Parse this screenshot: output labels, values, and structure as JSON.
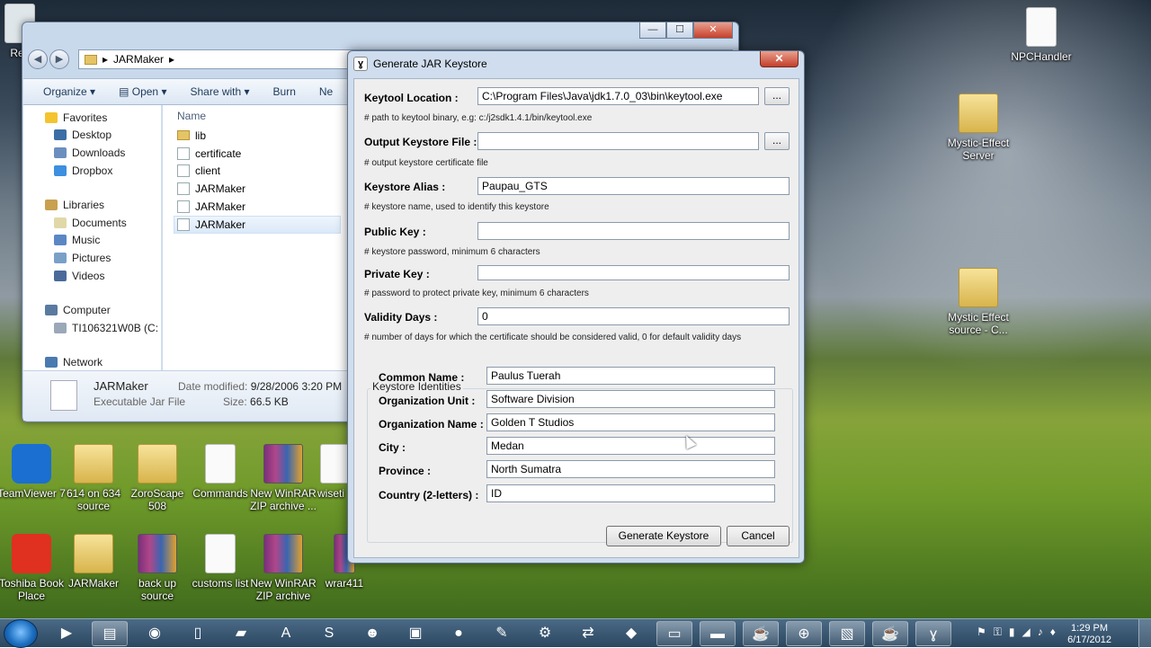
{
  "desktop": {
    "icons": [
      {
        "label": "Rec",
        "icon": "recycle-bin-icon"
      },
      {
        "label": "NPCHandler",
        "icon": "document-icon"
      },
      {
        "label": "Mystic-Effect Server",
        "icon": "folder-icon"
      },
      {
        "label": "Mystic Effect source - C...",
        "icon": "folder-icon"
      },
      {
        "label": "TeamViewer 7",
        "icon": "teamviewer-icon"
      },
      {
        "label": "614 on 634 source",
        "icon": "folder-icon"
      },
      {
        "label": "ZoroScape 508",
        "icon": "folder-icon"
      },
      {
        "label": "Commands",
        "icon": "document-icon"
      },
      {
        "label": "New WinRAR ZIP archive ...",
        "icon": "winrar-icon"
      },
      {
        "label": "wiseti",
        "icon": "document-icon"
      },
      {
        "label": "Toshiba Book Place",
        "icon": "toshiba-icon"
      },
      {
        "label": "JARMaker",
        "icon": "folder-icon"
      },
      {
        "label": "back up source",
        "icon": "winrar-icon"
      },
      {
        "label": "customs list",
        "icon": "document-icon"
      },
      {
        "label": "New WinRAR ZIP archive",
        "icon": "winrar-icon"
      },
      {
        "label": "wrar411",
        "icon": "winrar-icon"
      }
    ]
  },
  "explorer": {
    "breadcrumb": "JARMaker",
    "toolbar": {
      "organize": "Organize",
      "open": "Open",
      "share": "Share with",
      "burn": "Burn",
      "new": "Ne"
    },
    "nav": {
      "favorites": "Favorites",
      "fav_items": [
        "Desktop",
        "Downloads",
        "Dropbox"
      ],
      "libraries": "Libraries",
      "lib_items": [
        "Documents",
        "Music",
        "Pictures",
        "Videos"
      ],
      "computer": "Computer",
      "drive": "TI106321W0B (C:",
      "network": "Network"
    },
    "column_name": "Name",
    "files": [
      "lib",
      "certificate",
      "client",
      "JARMaker",
      "JARMaker",
      "JARMaker"
    ],
    "details": {
      "name": "JARMaker",
      "type": "Executable Jar File",
      "modified_label": "Date modified:",
      "modified": "9/28/2006 3:20 PM",
      "size_label": "Size:",
      "size": "66.5 KB"
    }
  },
  "dialog": {
    "title": "Generate JAR Keystore",
    "close": "✕",
    "keytool": {
      "label": "Keytool Location :",
      "value": "C:\\Program Files\\Java\\jdk1.7.0_03\\bin\\keytool.exe",
      "hint": "# path to keytool binary, e.g: c:/j2sdk1.4.1/bin/keytool.exe",
      "browse": "..."
    },
    "output": {
      "label": "Output Keystore File :",
      "value": "",
      "hint": "# output keystore certificate file",
      "browse": "..."
    },
    "alias": {
      "label": "Keystore Alias :",
      "value": "Paupau_GTS",
      "hint": "# keystore name, used to identify this keystore"
    },
    "public_key": {
      "label": "Public Key :",
      "value": "",
      "hint": "# keystore password, minimum 6 characters"
    },
    "private_key": {
      "label": "Private Key :",
      "value": "",
      "hint": "# password to protect private key, minimum 6 characters"
    },
    "validity": {
      "label": "Validity Days :",
      "value": "0",
      "hint": "# number of days for which the certificate should be considered valid, 0 for default validity days"
    },
    "identities_title": "Keystore Identities",
    "identities": [
      {
        "label": "Common Name :",
        "value": "Paulus Tuerah"
      },
      {
        "label": "Organization Unit :",
        "value": "Software Division"
      },
      {
        "label": "Organization Name :",
        "value": "Golden T Studios"
      },
      {
        "label": "City :",
        "value": "Medan"
      },
      {
        "label": "Province :",
        "value": "North Sumatra"
      },
      {
        "label": "Country (2-letters) :",
        "value": "ID"
      }
    ],
    "generate_button": "Generate Keystore",
    "cancel_button": "Cancel"
  },
  "taskbar": {
    "time": "1:29 PM",
    "date": "6/17/2012"
  }
}
